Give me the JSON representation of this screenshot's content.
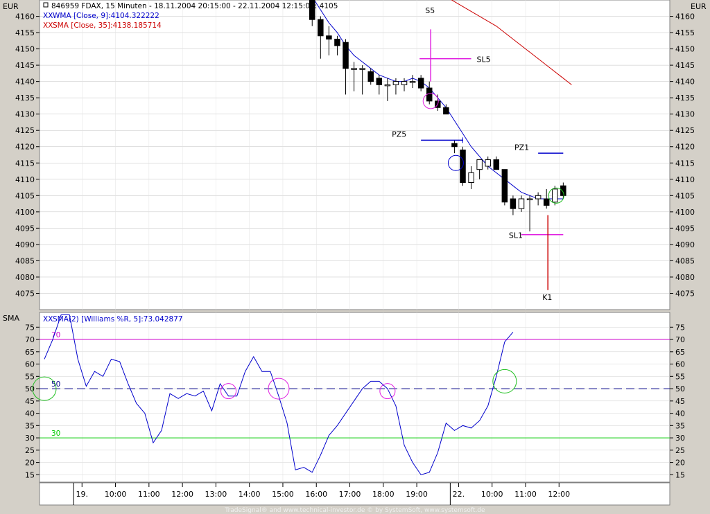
{
  "currency_left": "EUR",
  "currency_right": "EUR",
  "header": {
    "title": "846959  FDAX, 15 Minuten - 18.11.2004 20:15:00 - 22.11.2004 12:15:00: 4105",
    "wma_legend": "WMA [Close, 9]:4104.322222",
    "sma_legend": "SMA [Close, 35]:4138.185714"
  },
  "lower_panel": {
    "label": "SMA",
    "legend": "SMA(2) [Williams %R, 5]:73.042877"
  },
  "footer": "TradeSignal® and www.technical-investor.de © by SystemSoft, www.systemsoft.de",
  "colors": {
    "wma": "#0000cc",
    "sma": "#cc0000",
    "candle": "#000000",
    "signal_magenta": "#e020e0",
    "signal_blue": "#0000cc",
    "signal_red": "#cc0000",
    "signal_green": "#20c020",
    "line_70": "#cc00cc",
    "line_50": "#000088",
    "line_30": "#00cc00"
  },
  "chart_data": [
    {
      "type": "candlestick",
      "ylim": [
        4070,
        4165
      ],
      "yticks": [
        4075,
        4080,
        4085,
        4090,
        4095,
        4100,
        4105,
        4110,
        4115,
        4120,
        4125,
        4130,
        4135,
        4140,
        4145,
        4150,
        4155,
        4160
      ],
      "x_labels": [
        {
          "label": "19.",
          "bar": 4
        },
        {
          "label": "10:00",
          "bar": 8
        },
        {
          "label": "11:00",
          "bar": 12
        },
        {
          "label": "12:00",
          "bar": 16
        },
        {
          "label": "13:00",
          "bar": 20
        },
        {
          "label": "14:00",
          "bar": 24
        },
        {
          "label": "15:00",
          "bar": 28
        },
        {
          "label": "16:00",
          "bar": 32
        },
        {
          "label": "17:00",
          "bar": 36
        },
        {
          "label": "18:00",
          "bar": 40
        },
        {
          "label": "19:00",
          "bar": 44
        },
        {
          "label": "22.",
          "bar": 49
        },
        {
          "label": "10:00",
          "bar": 53
        },
        {
          "label": "11:00",
          "bar": 57
        },
        {
          "label": "12:00",
          "bar": 61
        }
      ],
      "candles": [
        {
          "bar": 32,
          "o": 4165,
          "h": 4166,
          "l": 4157,
          "c": 4159
        },
        {
          "bar": 33,
          "o": 4159,
          "h": 4160,
          "l": 4147,
          "c": 4154
        },
        {
          "bar": 34,
          "o": 4154,
          "h": 4157,
          "l": 4148,
          "c": 4153
        },
        {
          "bar": 35,
          "o": 4153,
          "h": 4154,
          "l": 4148,
          "c": 4151
        },
        {
          "bar": 36,
          "o": 4152,
          "h": 4153,
          "l": 4136,
          "c": 4144
        },
        {
          "bar": 37,
          "o": 4144,
          "h": 4146,
          "l": 4137,
          "c": 4144
        },
        {
          "bar": 38,
          "o": 4144,
          "h": 4145,
          "l": 4136,
          "c": 4144
        },
        {
          "bar": 39,
          "o": 4143,
          "h": 4144,
          "l": 4139,
          "c": 4140
        },
        {
          "bar": 40,
          "o": 4141,
          "h": 4142,
          "l": 4136,
          "c": 4139
        },
        {
          "bar": 41,
          "o": 4139,
          "h": 4141,
          "l": 4134,
          "c": 4139
        },
        {
          "bar": 42,
          "o": 4139,
          "h": 4141,
          "l": 4136,
          "c": 4140
        },
        {
          "bar": 43,
          "o": 4139,
          "h": 4141,
          "l": 4137,
          "c": 4140
        },
        {
          "bar": 44,
          "o": 4140,
          "h": 4142,
          "l": 4138,
          "c": 4140
        },
        {
          "bar": 45,
          "o": 4141,
          "h": 4142,
          "l": 4137,
          "c": 4138
        },
        {
          "bar": 46,
          "o": 4138,
          "h": 4140,
          "l": 4133,
          "c": 4134
        },
        {
          "bar": 47,
          "o": 4134,
          "h": 4136,
          "l": 4131,
          "c": 4132
        },
        {
          "bar": 48,
          "o": 4132,
          "h": 4133,
          "l": 4130,
          "c": 4130
        },
        {
          "bar": 49,
          "o": 4121,
          "h": 4122,
          "l": 4118,
          "c": 4120
        },
        {
          "bar": 50,
          "o": 4119,
          "h": 4120,
          "l": 4108,
          "c": 4109
        },
        {
          "bar": 51,
          "o": 4109,
          "h": 4114,
          "l": 4107,
          "c": 4112
        },
        {
          "bar": 52,
          "o": 4113,
          "h": 4116,
          "l": 4110,
          "c": 4116
        },
        {
          "bar": 53,
          "o": 4114,
          "h": 4117,
          "l": 4113,
          "c": 4116
        },
        {
          "bar": 54,
          "o": 4116,
          "h": 4117,
          "l": 4113,
          "c": 4113
        },
        {
          "bar": 55,
          "o": 4113,
          "h": 4113,
          "l": 4102,
          "c": 4103
        },
        {
          "bar": 56,
          "o": 4104,
          "h": 4105,
          "l": 4099,
          "c": 4101
        },
        {
          "bar": 57,
          "o": 4101,
          "h": 4105,
          "l": 4100,
          "c": 4104
        },
        {
          "bar": 58,
          "o": 4104,
          "h": 4105,
          "l": 4094,
          "c": 4104
        },
        {
          "bar": 59,
          "o": 4104,
          "h": 4106,
          "l": 4102,
          "c": 4105
        },
        {
          "bar": 60,
          "o": 4104,
          "h": 4107,
          "l": 4101,
          "c": 4102
        },
        {
          "bar": 61,
          "o": 4103,
          "h": 4108,
          "l": 4102,
          "c": 4107
        },
        {
          "bar": 62,
          "o": 4108,
          "h": 4109,
          "l": 4104,
          "c": 4105
        }
      ],
      "series": [
        {
          "name": "WMA [Close, 9]",
          "points": [
            [
              32,
              4166
            ],
            [
              33,
              4162
            ],
            [
              34,
              4158
            ],
            [
              35,
              4155
            ],
            [
              36,
              4151
            ],
            [
              37,
              4148
            ],
            [
              38,
              4146
            ],
            [
              39,
              4144
            ],
            [
              40,
              4142
            ],
            [
              41,
              4141
            ],
            [
              42,
              4140
            ],
            [
              43,
              4140
            ],
            [
              44,
              4141
            ],
            [
              45,
              4140
            ],
            [
              46,
              4138
            ],
            [
              47,
              4135
            ],
            [
              48,
              4132
            ],
            [
              49,
              4128
            ],
            [
              50,
              4124
            ],
            [
              51,
              4120
            ],
            [
              52,
              4117
            ],
            [
              53,
              4114
            ],
            [
              54,
              4112
            ],
            [
              55,
              4110
            ],
            [
              56,
              4108
            ],
            [
              57,
              4106
            ],
            [
              58,
              4105
            ],
            [
              59,
              4104
            ],
            [
              60,
              4104
            ],
            [
              61,
              4104
            ],
            [
              62,
              4104
            ]
          ]
        },
        {
          "name": "SMA [Close, 35]",
          "points": [
            [
              48,
              4166
            ],
            [
              50,
              4163
            ],
            [
              52,
              4160
            ],
            [
              54,
              4157
            ],
            [
              56,
              4153
            ],
            [
              58,
              4149
            ],
            [
              60,
              4145
            ],
            [
              62,
              4141
            ],
            [
              63,
              4139
            ]
          ]
        }
      ],
      "annotations": [
        {
          "label": "S5",
          "bar": 46,
          "y": 4161,
          "type": "vline_magenta",
          "from": 4156,
          "to": 4140
        },
        {
          "label": "SL5",
          "bar": 50,
          "y": 4146,
          "type": "hline_magenta",
          "from_bar": 45,
          "to_bar": 51,
          "level": 4147
        },
        {
          "label": "PZ5",
          "bar": 44,
          "y": 4123,
          "type": "hline_blue",
          "from_bar": 45,
          "to_bar": 50,
          "level": 4122
        },
        {
          "label": "PZ1",
          "bar": 57,
          "y": 4119,
          "type": "hline_blue",
          "from_bar": 59,
          "to_bar": 62,
          "level": 4118
        },
        {
          "label": "SL1",
          "bar": 56,
          "y": 4092,
          "type": "hline_magenta",
          "from_bar": 57,
          "to_bar": 62,
          "level": 4093
        },
        {
          "label": "K1",
          "bar": 60,
          "y": 4073,
          "type": "vline_red",
          "from": 4099,
          "to": 4076
        }
      ],
      "circles": [
        {
          "bar": 46,
          "y": 4134,
          "color": "magenta"
        },
        {
          "bar": 49,
          "y": 4115,
          "color": "blue"
        },
        {
          "bar": 61,
          "y": 4105,
          "color": "green"
        }
      ]
    },
    {
      "type": "line",
      "ylim": [
        12,
        81
      ],
      "yticks": [
        15,
        20,
        25,
        30,
        35,
        40,
        45,
        50,
        55,
        60,
        65,
        70,
        75
      ],
      "levels": [
        {
          "label": "70",
          "value": 70
        },
        {
          "label": "50",
          "value": 50
        },
        {
          "label": "30",
          "value": 30
        }
      ],
      "series": [
        {
          "name": "SMA(2) [Williams %R, 5]",
          "points": [
            [
              0,
              62
            ],
            [
              1,
              70
            ],
            [
              2,
              80
            ],
            [
              3,
              80
            ],
            [
              4,
              62
            ],
            [
              5,
              51
            ],
            [
              6,
              57
            ],
            [
              7,
              55
            ],
            [
              8,
              62
            ],
            [
              9,
              61
            ],
            [
              10,
              52
            ],
            [
              11,
              44
            ],
            [
              12,
              40
            ],
            [
              13,
              28
            ],
            [
              14,
              33
            ],
            [
              15,
              48
            ],
            [
              16,
              46
            ],
            [
              17,
              48
            ],
            [
              18,
              47
            ],
            [
              19,
              49
            ],
            [
              20,
              41
            ],
            [
              21,
              52
            ],
            [
              22,
              47
            ],
            [
              23,
              47
            ],
            [
              24,
              57
            ],
            [
              25,
              63
            ],
            [
              26,
              57
            ],
            [
              27,
              57
            ],
            [
              28,
              47
            ],
            [
              29,
              36
            ],
            [
              30,
              17
            ],
            [
              31,
              18
            ],
            [
              32,
              16
            ],
            [
              33,
              23
            ],
            [
              34,
              31
            ],
            [
              35,
              35
            ],
            [
              36,
              40
            ],
            [
              37,
              45
            ],
            [
              38,
              50
            ],
            [
              39,
              53
            ],
            [
              40,
              53
            ],
            [
              41,
              50
            ],
            [
              42,
              43
            ],
            [
              43,
              27
            ],
            [
              44,
              20
            ],
            [
              45,
              15
            ],
            [
              46,
              16
            ],
            [
              47,
              24
            ],
            [
              48,
              36
            ],
            [
              49,
              33
            ],
            [
              50,
              35
            ],
            [
              51,
              34
            ],
            [
              52,
              37
            ],
            [
              53,
              43
            ],
            [
              54,
              55
            ],
            [
              55,
              69
            ],
            [
              56,
              73
            ]
          ]
        }
      ],
      "circles": [
        {
          "x": 0,
          "y": 50,
          "color": "green"
        },
        {
          "x": 22,
          "y": 49,
          "color": "magenta"
        },
        {
          "x": 28,
          "y": 50,
          "color": "magenta"
        },
        {
          "x": 41,
          "y": 49,
          "color": "magenta"
        },
        {
          "x": 55,
          "y": 53,
          "color": "green"
        }
      ]
    }
  ]
}
